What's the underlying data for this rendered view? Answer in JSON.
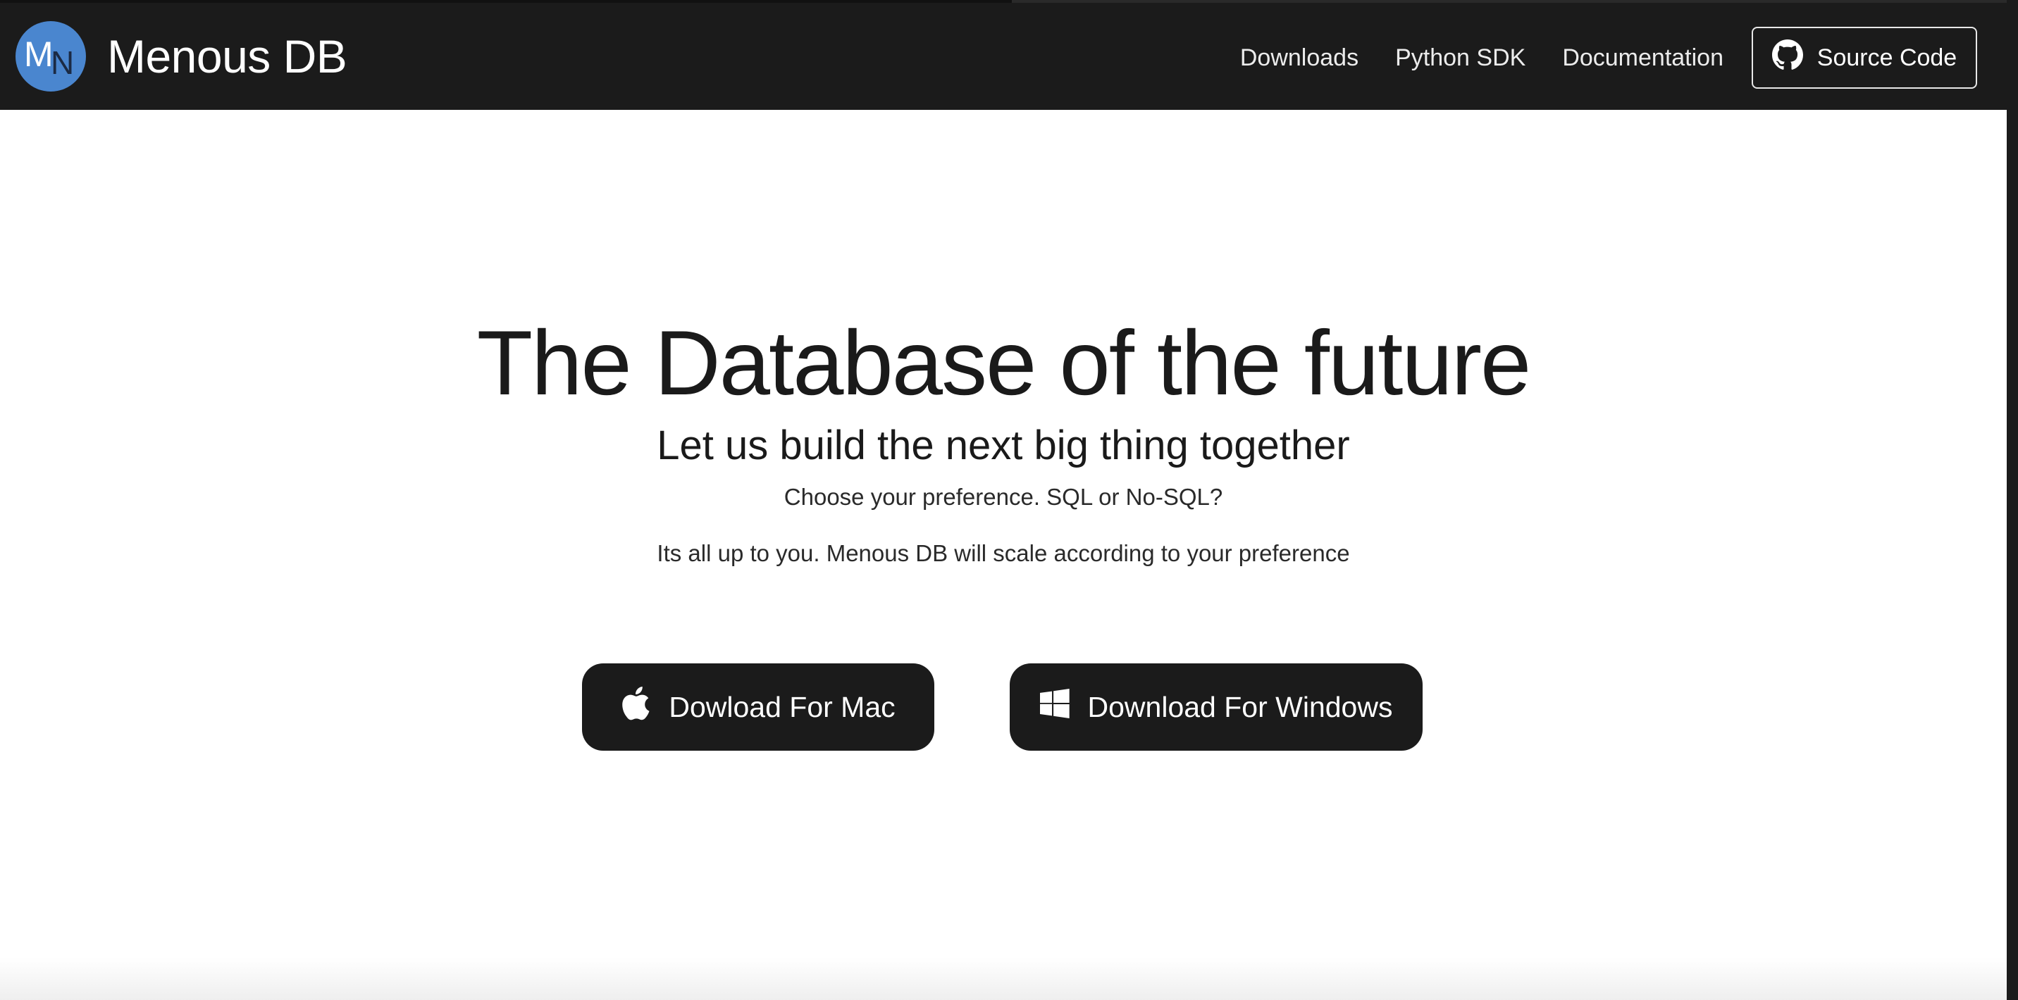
{
  "header": {
    "logo_letters": {
      "first": "M",
      "second": "N"
    },
    "brand_name": "Menous DB",
    "nav": [
      "Downloads",
      "Python SDK",
      "Documentation"
    ],
    "source_code_label": "Source Code",
    "source_icon": "github-icon"
  },
  "hero": {
    "title": "The Database of the future",
    "subtitle": "Let us build the next big thing together",
    "line1": "Choose your preference. SQL or No-SQL?",
    "line2": "Its all up to you. Menous DB will scale according to your preference"
  },
  "downloads": {
    "mac_label": "Dowload For Mac",
    "mac_icon": "apple-icon",
    "windows_label": "Download For Windows",
    "windows_icon": "windows-icon"
  },
  "colors": {
    "navbar": "#1b1b1b",
    "logo": "#4a86cf",
    "button": "#1b1b1b",
    "text": "#1a1a1a"
  }
}
